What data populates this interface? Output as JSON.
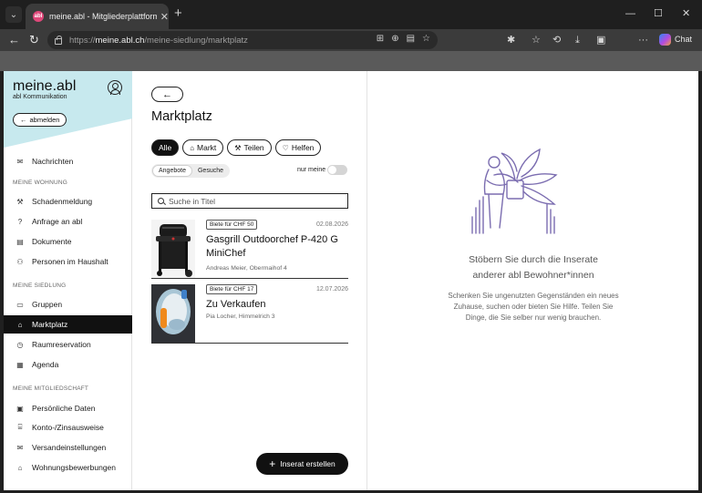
{
  "browser": {
    "tab_title": "meine.abl - Mitgliederplattform",
    "tab_favicon_text": "abl",
    "url_protocol": "https://",
    "url_host": "meine.abl.ch",
    "url_path": "/meine-siedlung/marktplatz",
    "chat_label": "Chat",
    "window_controls": [
      "—",
      "☐",
      "✕"
    ]
  },
  "sidebar": {
    "brand": "meine.abl",
    "brand_sub": "abl Kommunikation",
    "logout_label": "abmelden",
    "items": [
      {
        "label": "Nachrichten",
        "icon": "mail-icon"
      },
      {
        "label": "Schadenmeldung",
        "icon": "wrench-icon"
      },
      {
        "label": "Anfrage an abl",
        "icon": "question-icon"
      },
      {
        "label": "Dokumente",
        "icon": "document-icon"
      },
      {
        "label": "Personen im Haushalt",
        "icon": "people-icon"
      },
      {
        "label": "Gruppen",
        "icon": "chat-icon"
      },
      {
        "label": "Marktplatz",
        "icon": "shop-icon"
      },
      {
        "label": "Raumreservation",
        "icon": "calendar-clock-icon"
      },
      {
        "label": "Agenda",
        "icon": "calendar-icon"
      },
      {
        "label": "Persönliche Daten",
        "icon": "id-card-icon"
      },
      {
        "label": "Konto-/Zinsausweise",
        "icon": "bank-icon"
      },
      {
        "label": "Versandeinstellungen",
        "icon": "envelope-icon"
      },
      {
        "label": "Wohnungsbewerbungen",
        "icon": "home-icon"
      }
    ],
    "sections": {
      "wohnung": "MEINE WOHNUNG",
      "siedlung": "MEINE SIEDLUNG",
      "mitgliedschaft": "MEINE MITGLIEDSCHAFT"
    },
    "active_item": "Marktplatz"
  },
  "main": {
    "back_label": "←",
    "title": "Marktplatz",
    "chips": [
      {
        "label": "Alle",
        "active": true
      },
      {
        "label": "Markt",
        "active": false
      },
      {
        "label": "Teilen",
        "active": false
      },
      {
        "label": "Helfen",
        "active": false
      }
    ],
    "segments": [
      "Angebote",
      "Gesuche"
    ],
    "selected_segment": "Gesuche",
    "only_mine_label": "nur meine",
    "only_mine_enabled": false,
    "search_placeholder": "Suche in Titel",
    "listings": [
      {
        "badge": "Biete für CHF 50",
        "date": "02.08.2026",
        "title": "Gasgrill Outdoorchef P-420 G MiniChef",
        "subtitle": "Andreas Meier, Obermaihof 4"
      },
      {
        "badge": "Biete für CHF 17",
        "date": "12.07.2026",
        "title": "Zu Verkaufen",
        "subtitle": "Pia Locher, Himmelrich 3"
      }
    ],
    "create_label": "Inserat erstellen"
  },
  "empty_state": {
    "title": "Stöbern Sie durch die Inserate anderer abl Bewohner*innen",
    "text": "Schenken Sie ungenutzten Gegenständen ein neues Zuhause, suchen oder bieten Sie Hilfe. Teilen Sie Dinge, die Sie selber nur wenig brauchen."
  },
  "colors": {
    "accent_dark": "#111111",
    "sidebar_header": "#c7e9ee",
    "illustration_stroke": "#7b6db0"
  }
}
